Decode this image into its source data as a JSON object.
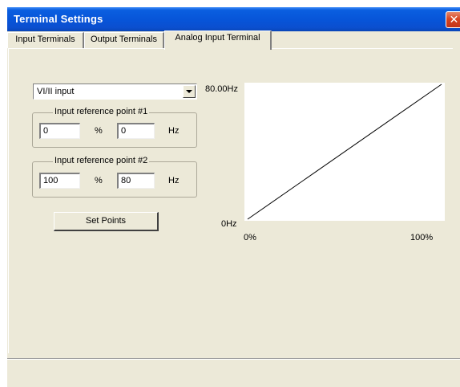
{
  "window": {
    "title": "Terminal Settings",
    "close_glyph": "✕"
  },
  "tabs": [
    {
      "label": "Input Terminals",
      "active": false
    },
    {
      "label": "Output Terminals",
      "active": false
    },
    {
      "label": "Analog Input Terminal",
      "active": true
    }
  ],
  "input_select": {
    "value": "VI/II input"
  },
  "ref_point_1": {
    "label": "Input reference point #1",
    "percent_value": "0",
    "percent_unit": "%",
    "freq_value": "0",
    "freq_unit": "Hz"
  },
  "ref_point_2": {
    "label": "Input reference point #2",
    "percent_value": "100",
    "percent_unit": "%",
    "freq_value": "80",
    "freq_unit": "Hz"
  },
  "set_points_button": "Set Points",
  "chart_data": {
    "type": "line",
    "title": "",
    "xlabel": "",
    "ylabel": "",
    "x_tick_labels": [
      "0%",
      "100%"
    ],
    "y_tick_labels": [
      "0Hz",
      "80.00Hz"
    ],
    "xlim": [
      0,
      100
    ],
    "ylim": [
      0,
      80
    ],
    "grid": false,
    "series": [
      {
        "x": [
          0,
          100
        ],
        "y": [
          0,
          80
        ]
      }
    ]
  },
  "colors": {
    "title_bar": "#0754d8",
    "face": "#ece9d8",
    "close_button": "#d84522",
    "plot_background": "#ffffff",
    "line": "#000000"
  }
}
